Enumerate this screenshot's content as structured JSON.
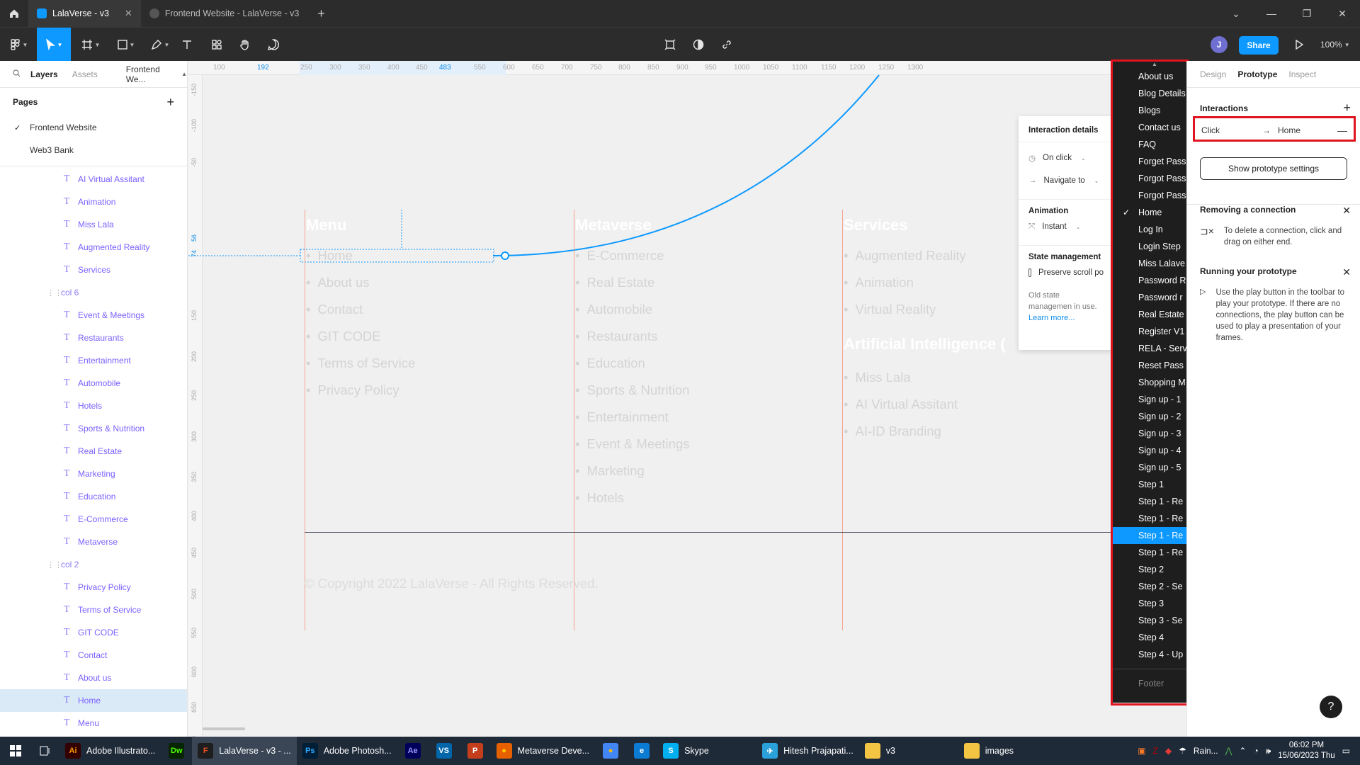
{
  "titlebar": {
    "tabs": [
      {
        "label": "LalaVerse - v3",
        "active": true
      },
      {
        "label": "Frontend Website - LalaVerse - v3",
        "active": false
      }
    ]
  },
  "toolbar": {
    "avatar_initial": "J",
    "share_label": "Share",
    "zoom": "100%"
  },
  "left_panel": {
    "tabs": [
      "Layers",
      "Assets",
      "Frontend We..."
    ],
    "pages_title": "Pages",
    "pages": [
      "Frontend Website",
      "Web3 Bank"
    ],
    "layers": [
      {
        "label": "AI Virtual Assitant",
        "type": "text"
      },
      {
        "label": "Animation",
        "type": "text"
      },
      {
        "label": "Miss Lala",
        "type": "text"
      },
      {
        "label": "Augmented Reality",
        "type": "text"
      },
      {
        "label": "Services",
        "type": "text"
      },
      {
        "label": "col 6",
        "type": "group"
      },
      {
        "label": "Event & Meetings",
        "type": "text"
      },
      {
        "label": "Restaurants",
        "type": "text"
      },
      {
        "label": "Entertainment",
        "type": "text"
      },
      {
        "label": "Automobile",
        "type": "text"
      },
      {
        "label": "Hotels",
        "type": "text"
      },
      {
        "label": "Sports & Nutrition",
        "type": "text"
      },
      {
        "label": "Real Estate",
        "type": "text"
      },
      {
        "label": "Marketing",
        "type": "text"
      },
      {
        "label": "Education",
        "type": "text"
      },
      {
        "label": "E-Commerce",
        "type": "text"
      },
      {
        "label": "Metaverse",
        "type": "text"
      },
      {
        "label": "col 2",
        "type": "group"
      },
      {
        "label": "Privacy Policy",
        "type": "text"
      },
      {
        "label": "Terms of Service",
        "type": "text"
      },
      {
        "label": "GIT CODE",
        "type": "text"
      },
      {
        "label": "Contact",
        "type": "text"
      },
      {
        "label": "About us",
        "type": "text"
      },
      {
        "label": "Home",
        "type": "text",
        "selected": true
      },
      {
        "label": "Menu",
        "type": "text"
      }
    ]
  },
  "canvas": {
    "ruler_top": [
      "100",
      "192",
      "250",
      "300",
      "350",
      "400",
      "450",
      "483",
      "550",
      "600",
      "650",
      "700",
      "750",
      "800",
      "850",
      "900",
      "950",
      "1000",
      "1050",
      "1100",
      "1150",
      "1200",
      "1250",
      "1300"
    ],
    "ruler_left": [
      "-150",
      "-100",
      "-50",
      "56",
      "74",
      "150",
      "200",
      "250",
      "300",
      "350",
      "400",
      "450",
      "500",
      "550",
      "600",
      "650",
      "700"
    ],
    "columns": [
      {
        "title": "Menu",
        "items": [
          "Home",
          "About us",
          "Contact",
          "GIT CODE",
          "Terms of Service",
          "Privacy Policy"
        ]
      },
      {
        "title": "Metaverse",
        "items": [
          "E-Commerce",
          "Real Estate",
          "Automobile",
          "Restaurants",
          "Education",
          "Sports & Nutrition",
          "Entertainment",
          "Event & Meetings",
          "Marketing",
          "Hotels"
        ]
      },
      {
        "title": "Services",
        "items": [
          "Augmented Reality",
          "Animation",
          "Virtual Reality"
        ],
        "subtitle": "Artificial Intelligence (",
        "sub_items": [
          "Miss Lala",
          "AI Virtual Assitant",
          "AI-ID Branding"
        ]
      }
    ],
    "copyright": "© Copyright 2022 LalaVerse - All Rights Reserved.",
    "interaction_details": {
      "title": "Interaction details",
      "trigger": "On click",
      "action": "Navigate to",
      "animation_title": "Animation",
      "animation": "Instant",
      "state_title": "State management",
      "preserve": "Preserve scroll po",
      "note": "Old state managemen in use.",
      "learn_more": "Learn more..."
    }
  },
  "dropdown": {
    "items": [
      {
        "label": "About us"
      },
      {
        "label": "Blog Details"
      },
      {
        "label": "Blogs"
      },
      {
        "label": "Contact us"
      },
      {
        "label": "FAQ"
      },
      {
        "label": "Forget Pass"
      },
      {
        "label": "Forgot Pass"
      },
      {
        "label": "Forgot Pass"
      },
      {
        "label": "Home",
        "checked": true
      },
      {
        "label": "Log In"
      },
      {
        "label": "Login Step"
      },
      {
        "label": "Miss Lalave"
      },
      {
        "label": "Password R"
      },
      {
        "label": "Password r"
      },
      {
        "label": "Real Estate"
      },
      {
        "label": "Register V1"
      },
      {
        "label": "RELA - Serv"
      },
      {
        "label": "Reset Pass"
      },
      {
        "label": "Shopping M"
      },
      {
        "label": "Sign up - 1"
      },
      {
        "label": "Sign up - 2"
      },
      {
        "label": "Sign up - 3"
      },
      {
        "label": "Sign up - 4"
      },
      {
        "label": "Sign up - 5"
      },
      {
        "label": "Step 1"
      },
      {
        "label": "Step 1 - Re"
      },
      {
        "label": "Step 1 - Re"
      },
      {
        "label": "Step 1 - Re",
        "highlighted": true
      },
      {
        "label": "Step 1 - Re"
      },
      {
        "label": "Step 2"
      },
      {
        "label": "Step 2 - Se"
      },
      {
        "label": "Step 3"
      },
      {
        "label": "Step 3 - Se"
      },
      {
        "label": "Step 4"
      },
      {
        "label": "Step 4 - Up"
      }
    ],
    "footer": "Footer"
  },
  "right_panel": {
    "tabs": [
      "Design",
      "Prototype",
      "Inspect"
    ],
    "interactions_title": "Interactions",
    "interaction": {
      "trigger": "Click",
      "target": "Home"
    },
    "prototype_settings": "Show prototype settings",
    "removing_title": "Removing a connection",
    "removing_text": "To delete a connection, click and drag on either end.",
    "running_title": "Running your prototype",
    "running_text": "Use the play button in the toolbar to play your prototype. If there are no connections, the play button can be used to play a presentation of your frames.",
    "help": "?"
  },
  "taskbar": {
    "apps": [
      {
        "label": "Adobe Illustrato...",
        "icon": "Ai",
        "color": "#330000",
        "fg": "#ff9a00"
      },
      {
        "label": "",
        "icon": "Dw",
        "color": "#072401",
        "fg": "#4aff00"
      },
      {
        "label": "LalaVerse - v3 - ...",
        "icon": "F",
        "color": "#1e1e1e",
        "fg": "#f24e1e",
        "active": true
      },
      {
        "label": "Adobe Photosh...",
        "icon": "Ps",
        "color": "#001e36",
        "fg": "#31a8ff"
      },
      {
        "label": "",
        "icon": "Ae",
        "color": "#00005b",
        "fg": "#9999ff"
      },
      {
        "label": "",
        "icon": "VS",
        "color": "#0065a9",
        "fg": "#ffffff"
      },
      {
        "label": "",
        "icon": "P",
        "color": "#c43e1c",
        "fg": "#ffffff"
      },
      {
        "label": "Metaverse Deve...",
        "icon": "●",
        "color": "#e66000",
        "fg": "#ffcb00"
      },
      {
        "label": "",
        "icon": "●",
        "color": "#4285f4",
        "fg": "#fbbc05"
      },
      {
        "label": "",
        "icon": "e",
        "color": "#0c7bd4",
        "fg": "#ffffff"
      },
      {
        "label": "Skype",
        "icon": "S",
        "color": "#00aff0",
        "fg": "#ffffff"
      },
      {
        "label": "Hitesh Prajapati...",
        "icon": "✈",
        "color": "#2aa1da",
        "fg": "#ffffff"
      },
      {
        "label": "v3",
        "icon": "▬",
        "color": "#f4c542",
        "fg": "#f4c542"
      },
      {
        "label": "images",
        "icon": "▬",
        "color": "#f4c542",
        "fg": "#f4c542"
      }
    ],
    "weather": "Rain...",
    "time": "06:02 PM",
    "date": "15/06/2023 Thu"
  }
}
